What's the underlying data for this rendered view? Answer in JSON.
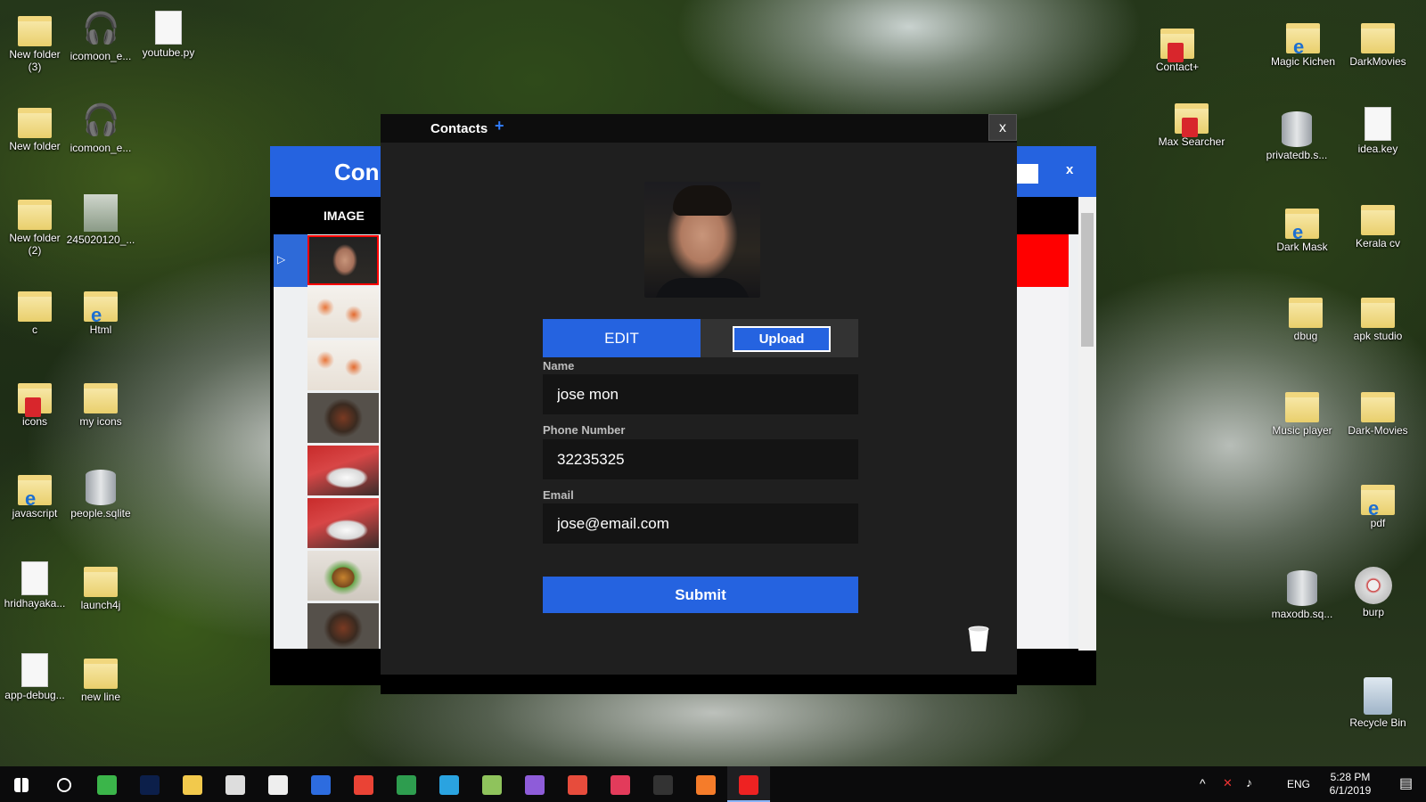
{
  "desktop_left": [
    {
      "label": "New folder\n(3)",
      "icon": "folder-icon",
      "col": 0,
      "row": 0
    },
    {
      "label": "icomoon_e...",
      "icon": "headphones-icon",
      "col": 1,
      "row": 0
    },
    {
      "label": "youtube.py",
      "icon": "python-file-icon",
      "col": 2,
      "row": 0
    },
    {
      "label": "New folder",
      "icon": "folder-icon",
      "col": 0,
      "row": 1
    },
    {
      "label": "icomoon_e...",
      "icon": "headphones-icon",
      "col": 1,
      "row": 1
    },
    {
      "label": "New folder\n(2)",
      "icon": "folder-icon",
      "col": 0,
      "row": 2
    },
    {
      "label": "245020120_...",
      "icon": "image-file-icon",
      "col": 1,
      "row": 2
    },
    {
      "label": "c",
      "icon": "folder-icon",
      "col": 0,
      "row": 3
    },
    {
      "label": "Html",
      "icon": "html-folder-icon",
      "col": 1,
      "row": 3
    },
    {
      "label": "icons",
      "icon": "red-folder-icon",
      "col": 0,
      "row": 4
    },
    {
      "label": "my icons",
      "icon": "folder-icon",
      "col": 1,
      "row": 4
    },
    {
      "label": "javascript",
      "icon": "ie-folder-icon",
      "col": 0,
      "row": 5
    },
    {
      "label": "people.sqlite",
      "icon": "database-icon",
      "col": 1,
      "row": 5
    },
    {
      "label": "hridhayaka...",
      "icon": "file-icon",
      "col": 0,
      "row": 6
    },
    {
      "label": "launch4j",
      "icon": "folder-icon",
      "col": 1,
      "row": 6
    },
    {
      "label": "app-debug...",
      "icon": "file-icon",
      "col": 0,
      "row": 7
    },
    {
      "label": "new line",
      "icon": "folder-icon",
      "col": 1,
      "row": 7
    }
  ],
  "desktop_right": [
    {
      "label": "Contact+",
      "icon": "red-folder-icon"
    },
    {
      "label": "Magic Kichen",
      "icon": "ie-folder-icon"
    },
    {
      "label": "DarkMovies",
      "icon": "folder-icon"
    },
    {
      "label": "Max Searcher",
      "icon": "red-folder-icon"
    },
    {
      "label": "privatedb.s...",
      "icon": "database-icon"
    },
    {
      "label": "idea.key",
      "icon": "file-icon"
    },
    {
      "label": "Dark Mask",
      "icon": "ie-folder-icon"
    },
    {
      "label": "Kerala cv",
      "icon": "folder-icon"
    },
    {
      "label": "dbug",
      "icon": "folder-icon"
    },
    {
      "label": "apk studio",
      "icon": "folder-icon"
    },
    {
      "label": "Music player",
      "icon": "folder-icon"
    },
    {
      "label": "Dark-Movies",
      "icon": "folder-icon"
    },
    {
      "label": "pdf",
      "icon": "ie-folder-icon"
    },
    {
      "label": "maxodb.sq...",
      "icon": "database-icon"
    },
    {
      "label": "burp",
      "icon": "disc-icon"
    },
    {
      "label": "Recycle Bin",
      "icon": "recycle-bin-icon"
    }
  ],
  "back_window": {
    "title": "Con",
    "close": "x",
    "column_image": "IMAGE",
    "rows": [
      {
        "thumb": "portrait",
        "active": true
      },
      {
        "thumb": "shrimp"
      },
      {
        "thumb": "shrimp"
      },
      {
        "thumb": "pan"
      },
      {
        "thumb": "plate"
      },
      {
        "thumb": "plate"
      },
      {
        "thumb": "burger"
      },
      {
        "thumb": "pan"
      }
    ]
  },
  "dialog": {
    "title": "Contacts",
    "plus": "+",
    "close": "x",
    "tab_edit": "EDIT",
    "tab_upload": "Upload",
    "name_label": "Name",
    "name_value": "jose mon",
    "phone_label": "Phone Number",
    "phone_value": "32235325",
    "email_label": "Email",
    "email_value": "jose@email.com",
    "submit": "Submit"
  },
  "taskbar": {
    "apps": [
      "start",
      "cortana",
      "camtasia",
      "photoshop",
      "file-explorer",
      "mail",
      "file",
      "firefox",
      "chrome",
      "gem",
      "telegram",
      "notepad",
      "visual-studio",
      "red-app",
      "search-app",
      "terminal",
      "xampp",
      "contact-app"
    ],
    "active_index": 17,
    "lang": "ENG",
    "time": "5:28 PM",
    "date": "6/1/2019"
  },
  "colors": {
    "accent": "#2563e0",
    "dialog_bg": "#1f1f1f",
    "active_row": "#ff0000"
  }
}
